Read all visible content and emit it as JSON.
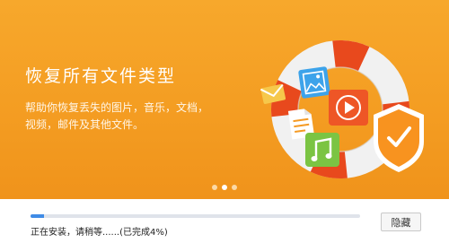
{
  "banner": {
    "headline": "恢复所有文件类型",
    "description_line1": "帮助你恢复丢失的图片，音乐，文档，",
    "description_line2": "视频，邮件及其他文件。",
    "carousel_active_index": 1
  },
  "install": {
    "status_text": "正在安装，请稍等......(已完成4%)",
    "progress_fraction": 0.04,
    "hide_button_label": "隐藏"
  },
  "colors": {
    "banner_orange": "#f49d22",
    "ring_red": "#e8491d",
    "shield_orange": "#f8931f",
    "progress_blue": "#3f8be6"
  },
  "icons": [
    "email-icon",
    "image-icon",
    "video-play-icon",
    "document-icon",
    "music-icon",
    "shield-check-icon",
    "lifebuoy-icon"
  ]
}
